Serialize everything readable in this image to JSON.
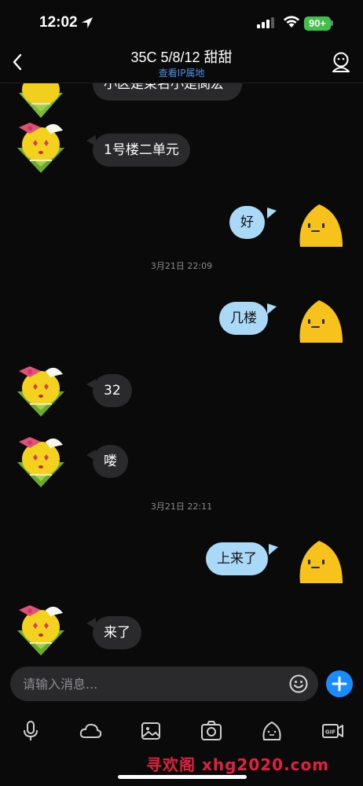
{
  "status_bar": {
    "time": "12:02",
    "battery": "90+"
  },
  "header": {
    "title": "35C 5/8/12 甜甜",
    "ip_link": "查看IP属地"
  },
  "messages": [
    {
      "side": "in",
      "text": "小区是東名小是阆宏"
    },
    {
      "side": "in",
      "text": "1号楼二单元"
    },
    {
      "side": "out",
      "text": "好"
    },
    {
      "side": "out",
      "text": "几楼"
    },
    {
      "side": "in",
      "text": "32"
    },
    {
      "side": "in",
      "text": "喽"
    },
    {
      "side": "out",
      "text": "上来了"
    },
    {
      "side": "in",
      "text": "来了"
    }
  ],
  "timestamps": [
    "3月21日 22:09",
    "3月21日 22:11"
  ],
  "input": {
    "placeholder": "请输入消息..."
  },
  "toolbar": [
    "mic-icon",
    "cloud-icon",
    "image-icon",
    "camera-icon",
    "sticker-icon",
    "gif-icon"
  ],
  "watermark": "寻欢阁 xhg2020.com",
  "colors": {
    "background": "#0a0a0a",
    "bubble_in": "#2a2a2c",
    "bubble_out": "#a9d9f7",
    "accent": "#1a8cff",
    "link": "#4a90e2",
    "battery": "#3ec24a"
  }
}
